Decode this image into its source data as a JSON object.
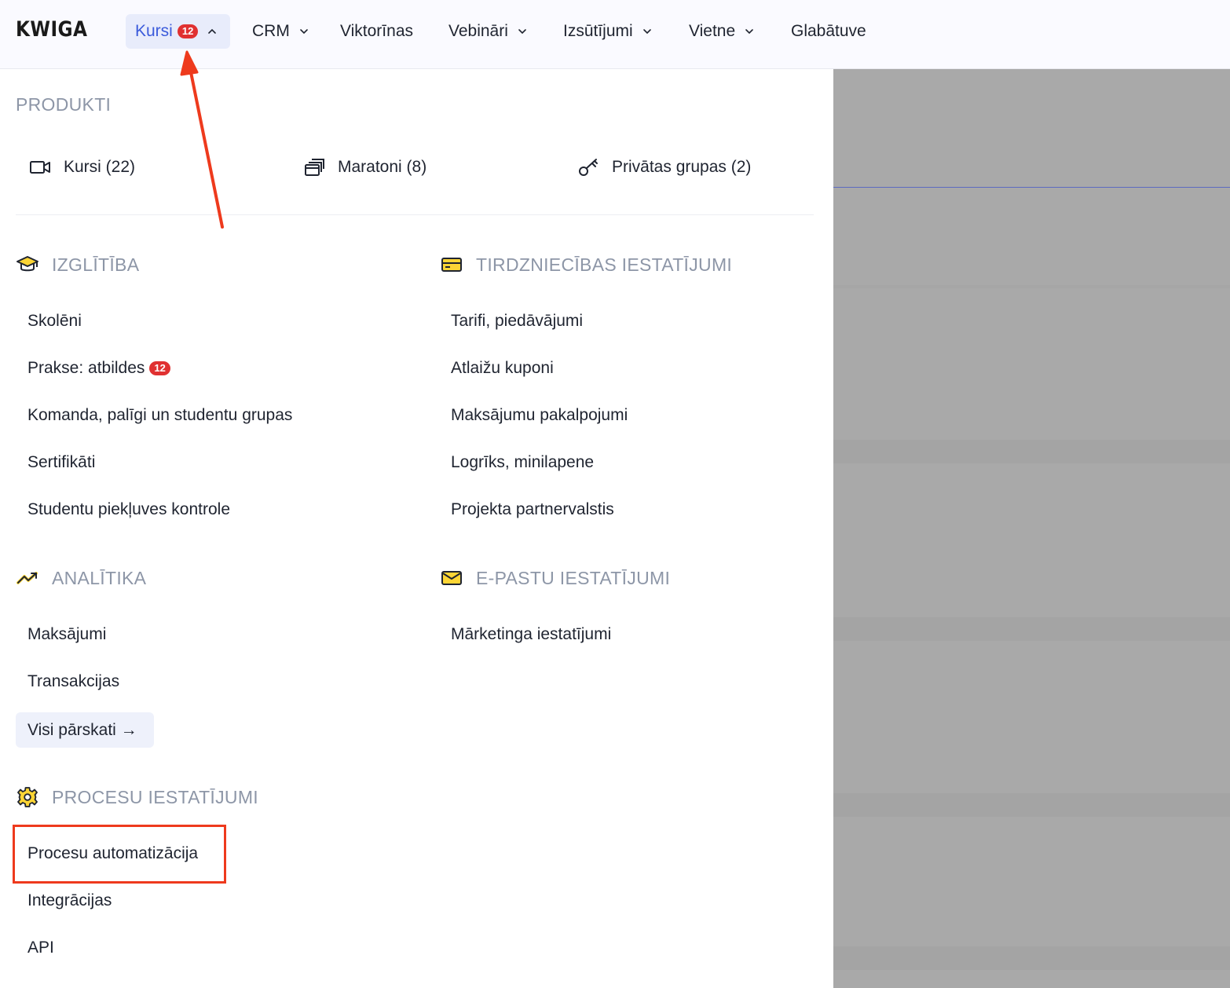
{
  "brand": {
    "logo": "KWIGA"
  },
  "nav": {
    "items": [
      {
        "label": "Kursi",
        "badge": "12",
        "active": true,
        "chevron": "chevron-up-icon"
      },
      {
        "label": "CRM",
        "chevron": "chevron-down-icon"
      },
      {
        "label": "Viktorīnas"
      },
      {
        "label": "Vebināri",
        "chevron": "chevron-down-icon"
      },
      {
        "label": "Izsūtījumi",
        "chevron": "chevron-down-icon"
      },
      {
        "label": "Vietne",
        "chevron": "chevron-down-icon"
      },
      {
        "label": "Glabātuve"
      }
    ]
  },
  "menu": {
    "products": {
      "title": "PRODUKTI",
      "items": [
        {
          "label": "Kursi (22)",
          "icon": "video-camera-icon"
        },
        {
          "label": "Maratoni (8)",
          "icon": "stacked-cards-icon"
        },
        {
          "label": "Privātas grupas (2)",
          "icon": "key-icon"
        }
      ]
    },
    "education": {
      "title": "IZGLĪTĪBA",
      "icon": "graduation-cap-icon",
      "items": [
        {
          "label": "Skolēni"
        },
        {
          "label": "Prakse: atbildes",
          "badge": "12"
        },
        {
          "label": "Komanda, palīgi un studentu grupas"
        },
        {
          "label": "Sertifikāti"
        },
        {
          "label": "Studentu piekļuves kontrole"
        }
      ]
    },
    "trade": {
      "title": "TIRDZNIECĪBAS IESTATĪJUMI",
      "icon": "credit-card-icon",
      "items": [
        {
          "label": "Tarifi, piedāvājumi"
        },
        {
          "label": "Atlaižu kuponi"
        },
        {
          "label": "Maksājumu pakalpojumi"
        },
        {
          "label": "Logrīks, minilapene"
        },
        {
          "label": "Projekta partnervalstis"
        }
      ]
    },
    "analytics": {
      "title": "ANALĪTIKA",
      "icon": "trending-up-icon",
      "items": [
        {
          "label": "Maksājumi"
        },
        {
          "label": "Transakcijas"
        }
      ],
      "more": "Visi pārskati →"
    },
    "email": {
      "title": "E-PASTU IESTATĪJUMI",
      "icon": "envelope-icon",
      "items": [
        {
          "label": "Mārketinga iestatījumi"
        }
      ]
    },
    "process": {
      "title": "PROCESU IESTATĪJUMI",
      "icon": "gear-icon",
      "items": [
        {
          "label": "Procesu automatizācija",
          "highlighted": true
        },
        {
          "label": "Integrācijas"
        },
        {
          "label": "API"
        }
      ]
    }
  },
  "colors": {
    "accent": "#3b5bdb",
    "badge": "#e03131",
    "annotation": "#ee3a1d",
    "icon_yellow": "#fcd535",
    "overlay": "#a9a9a9"
  }
}
